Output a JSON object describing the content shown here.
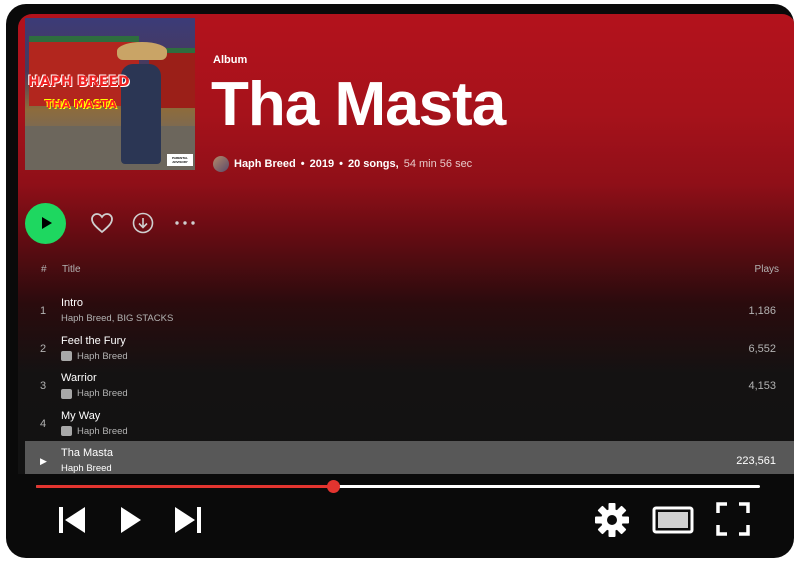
{
  "album": {
    "type_label": "Album",
    "title": "Tha Masta",
    "artist": "Haph Breed",
    "year": "2019",
    "song_count": "20 songs,",
    "duration": "54 min 56 sec",
    "separator": "•",
    "cover_text_1": "HAPH BREED",
    "cover_text_2": "THA MASTA",
    "cover_badge": "PARENTAL ADVISORY"
  },
  "controls": {
    "play_icon": "play-icon",
    "like_icon": "heart-icon",
    "download_icon": "download-icon",
    "more_icon": "more-icon"
  },
  "table": {
    "header": {
      "number": "#",
      "title": "Title",
      "plays": "Plays"
    },
    "tracks": [
      {
        "number": "1",
        "title": "Intro",
        "artists": "Haph Breed, BIG STACKS",
        "explicit": false,
        "plays": "1,186"
      },
      {
        "number": "2",
        "title": "Feel the Fury",
        "artists": "Haph Breed",
        "explicit": true,
        "plays": "6,552"
      },
      {
        "number": "3",
        "title": "Warrior",
        "artists": "Haph Breed",
        "explicit": true,
        "plays": "4,153"
      },
      {
        "number": "4",
        "title": "My Way",
        "artists": "Haph Breed",
        "explicit": true,
        "plays": ""
      },
      {
        "number": "▶",
        "title": "Tha Masta",
        "artists": "Haph Breed",
        "explicit": false,
        "plays": "223,561",
        "active": true
      }
    ]
  },
  "player": {
    "progress": 0.41,
    "colors": {
      "progress": "#e3342f",
      "track": "#ffffff",
      "accent": "#1ed760"
    },
    "buttons": [
      "previous-icon",
      "play-icon",
      "next-icon",
      "settings-icon",
      "theater-icon",
      "fullscreen-icon"
    ]
  }
}
